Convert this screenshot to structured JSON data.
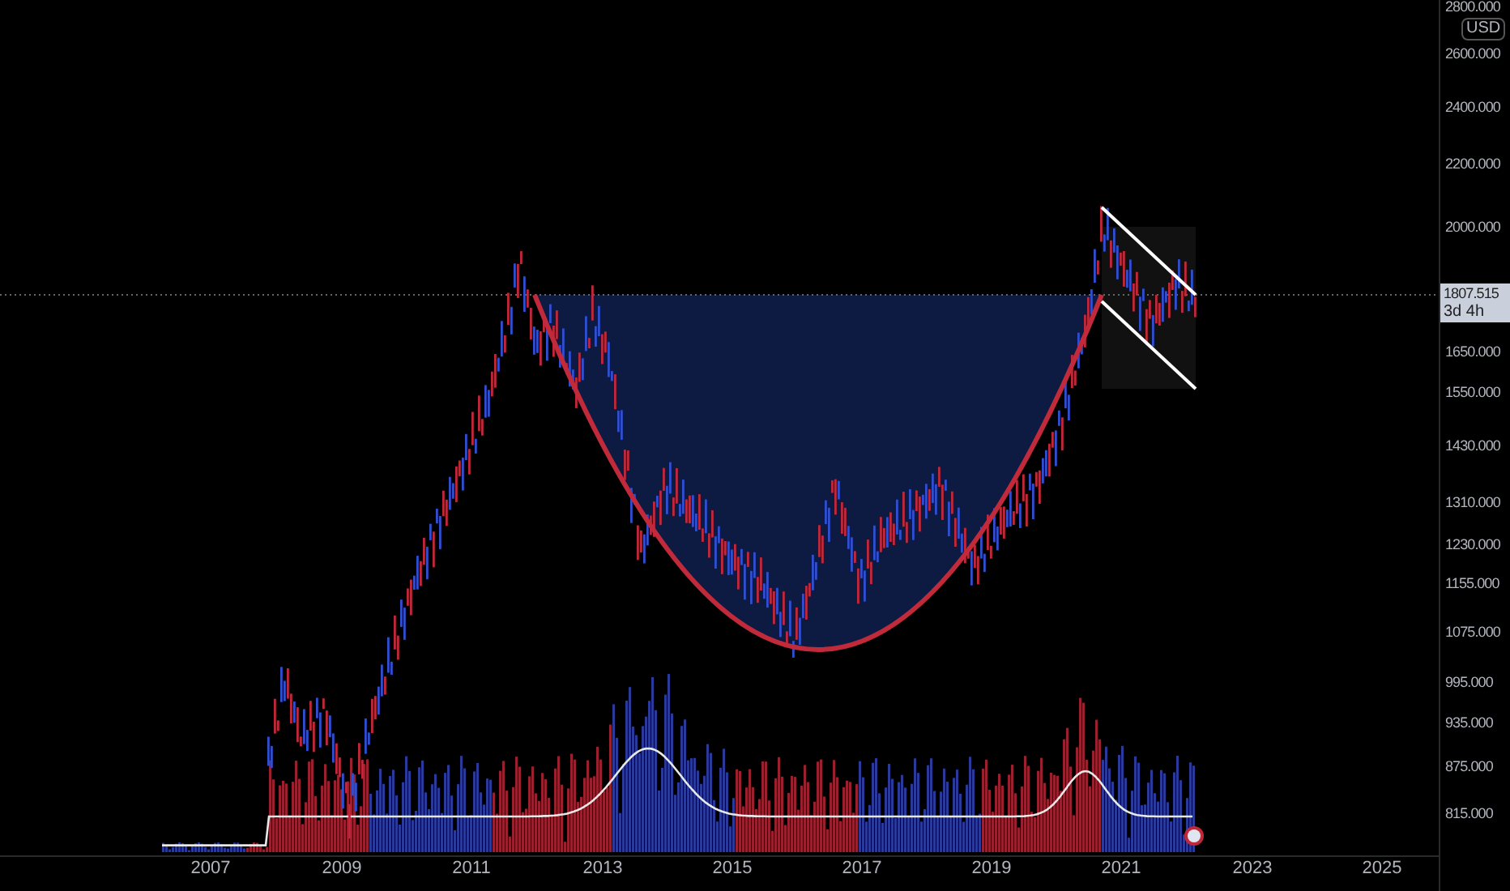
{
  "price_axis": {
    "currency": "USD",
    "labels": [
      "2800.000",
      "2600.000",
      "2400.000",
      "2200.000",
      "2000.000",
      "1650.000",
      "1550.000",
      "1430.000",
      "1310.000",
      "1230.000",
      "1155.000",
      "1075.000",
      "995.000",
      "935.000",
      "875.000",
      "815.000"
    ]
  },
  "last_price": {
    "value": "1807.515",
    "countdown": "3d 4h"
  },
  "time_axis": {
    "labels": [
      "2007",
      "2009",
      "2011",
      "2013",
      "2015",
      "2017",
      "2019",
      "2021",
      "2023",
      "2025"
    ]
  }
}
